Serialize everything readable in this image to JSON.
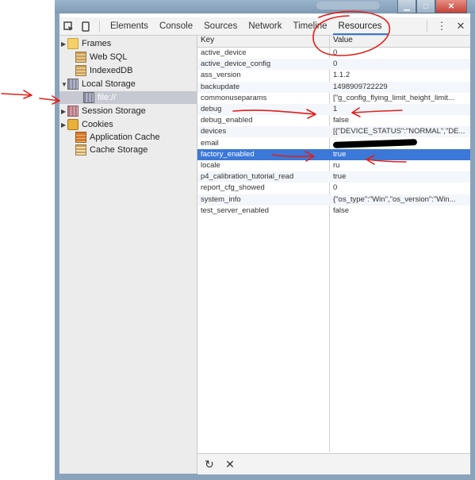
{
  "toolbar": {
    "tabs": [
      "Elements",
      "Console",
      "Sources",
      "Network",
      "Timeline",
      "Resources"
    ],
    "active_tab": "Resources"
  },
  "tree": [
    {
      "label": "Frames",
      "icon": "folder-icon",
      "arrow": "▶"
    },
    {
      "label": "Web SQL",
      "icon": "database-icon",
      "arrow": ""
    },
    {
      "label": "IndexedDB",
      "icon": "database-icon",
      "arrow": ""
    },
    {
      "label": "Local Storage",
      "icon": "storage-grid-icon",
      "arrow": "▼"
    },
    {
      "label": "file://",
      "icon": "storage-grid-icon",
      "arrow": ""
    },
    {
      "label": "Session Storage",
      "icon": "storage-grid-icon",
      "arrow": "▶"
    },
    {
      "label": "Cookies",
      "icon": "cookie-icon",
      "arrow": "▶"
    },
    {
      "label": "Application Cache",
      "icon": "app-cache-icon",
      "arrow": ""
    },
    {
      "label": "Cache Storage",
      "icon": "cache-storage-icon",
      "arrow": ""
    }
  ],
  "grid": {
    "headers": {
      "key": "Key",
      "value": "Value"
    },
    "rows": [
      {
        "key": "active_device",
        "value": "0"
      },
      {
        "key": "active_device_config",
        "value": "0"
      },
      {
        "key": "ass_version",
        "value": "1.1.2"
      },
      {
        "key": "backupdate",
        "value": "1498909722229"
      },
      {
        "key": "commonuseparams",
        "value": "[\"g_config_flying_limit_height_limit..."
      },
      {
        "key": "debug",
        "value": "1"
      },
      {
        "key": "debug_enabled",
        "value": "false"
      },
      {
        "key": "devices",
        "value": "[{\"DEVICE_STATUS\":\"NORMAL\",\"DE..."
      },
      {
        "key": "email",
        "value": ""
      },
      {
        "key": "factory_enabled",
        "value": "true"
      },
      {
        "key": "locale",
        "value": "ru"
      },
      {
        "key": "p4_calibration_tutorial_read",
        "value": "true"
      },
      {
        "key": "report_cfg_showed",
        "value": "0"
      },
      {
        "key": "system_info",
        "value": "{\"os_type\":\"Win\",\"os_version\":\"Win..."
      },
      {
        "key": "test_server_enabled",
        "value": "false"
      }
    ],
    "selected_key": "factory_enabled"
  },
  "colors": {
    "selection": "#3b78d8",
    "annotation": "#e0201a"
  }
}
